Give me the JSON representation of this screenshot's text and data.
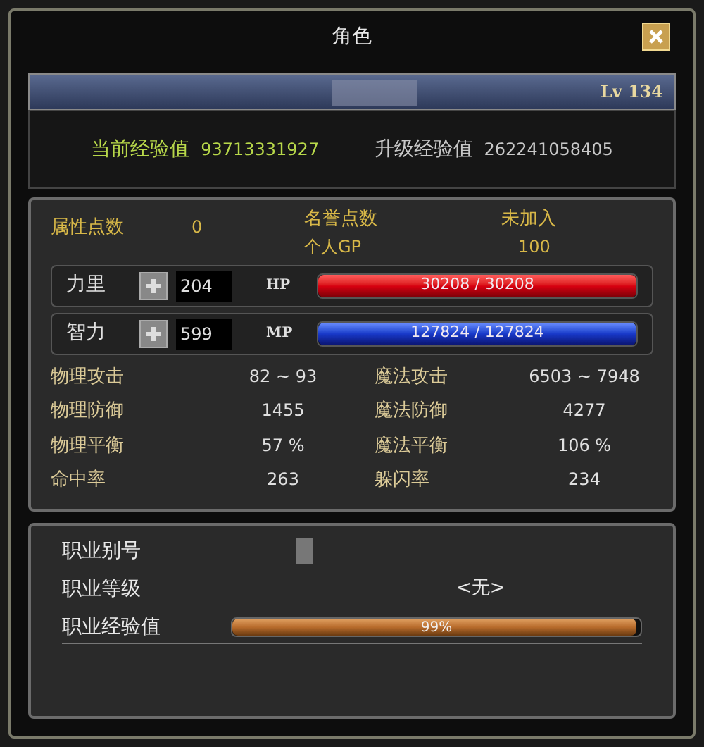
{
  "window": {
    "title": "角色"
  },
  "header": {
    "level": "Lv 134"
  },
  "experience": [
    {
      "label": "当前经验值",
      "value": "93713331927",
      "kind": "current"
    },
    {
      "label": "升级经验值",
      "value": "262241058405",
      "kind": "next"
    }
  ],
  "points": {
    "label": "属性点数",
    "value": "0"
  },
  "honor": {
    "label": "名誉点数",
    "value": "未加入",
    "gp_label": "个人GP",
    "gp_value": "100"
  },
  "attributes": [
    {
      "name": "力里",
      "value": "204",
      "bar_label": "HP",
      "reading": "30208 / 30208",
      "level": 1,
      "kind": "hp"
    },
    {
      "name": "智力",
      "value": "599",
      "bar_label": "MP",
      "reading": "127824 / 127824",
      "level": 1,
      "kind": "mp"
    }
  ],
  "stats": [
    {
      "label": "物理攻击",
      "value": "82 ~ 93"
    },
    {
      "label": "魔法攻击",
      "value": "6503 ~ 7948"
    },
    {
      "label": "物理防御",
      "value": "1455"
    },
    {
      "label": "魔法防御",
      "value": "4277"
    },
    {
      "label": "物理平衡",
      "value": "57 %"
    },
    {
      "label": "魔法平衡",
      "value": "106 %"
    },
    {
      "label": "命中率",
      "value": "263"
    },
    {
      "label": "躲闪率",
      "value": "234"
    }
  ],
  "job": {
    "alias_label": "职业别号",
    "grade_label": "职业等级",
    "grade_value": "<无>",
    "exp_label": "职业经验值",
    "exp_reading": "99%",
    "level": 0.99
  }
}
